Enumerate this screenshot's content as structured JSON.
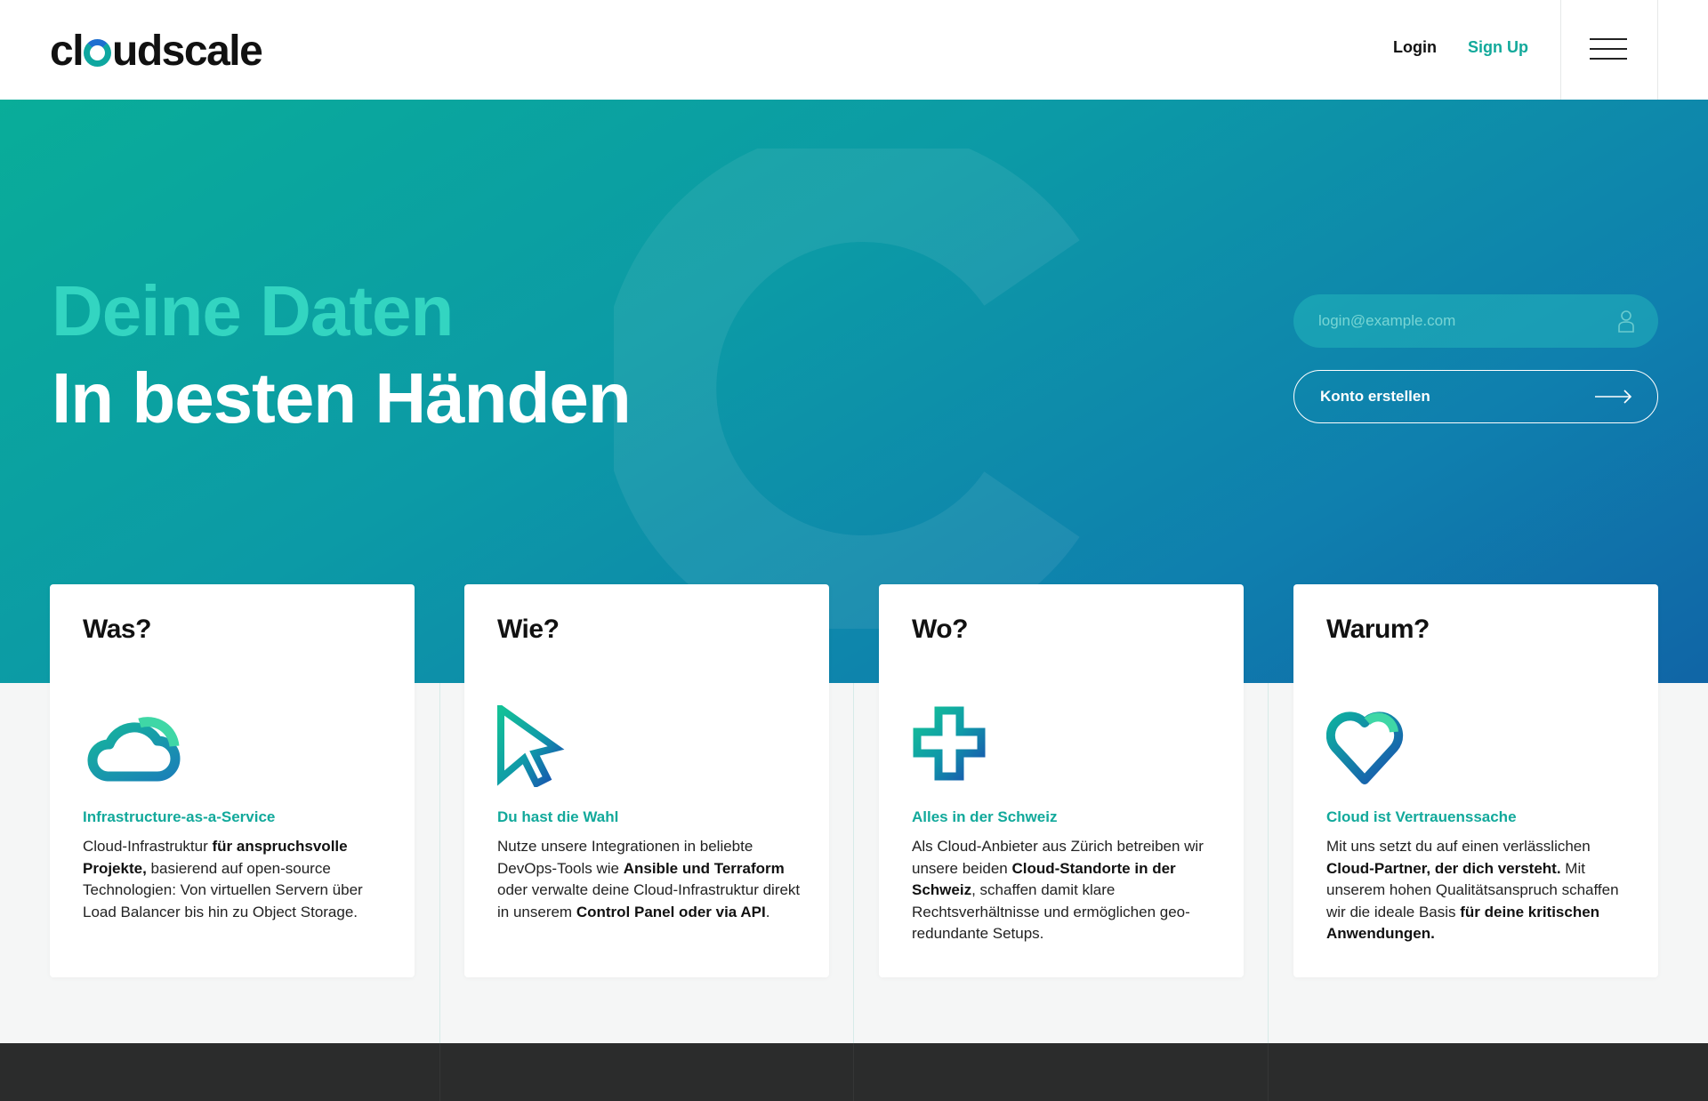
{
  "header": {
    "logo_pre": "cl",
    "logo_post": "udscale",
    "login_label": "Login",
    "signup_label": "Sign Up"
  },
  "hero": {
    "title_line1": "Deine Daten",
    "title_line2": "In besten Händen",
    "email_placeholder": "login@example.com",
    "cta_label": "Konto erstellen"
  },
  "cards": [
    {
      "heading": "Was?",
      "icon": "cloud-icon",
      "subtitle": "Infrastructure-as-a-Service",
      "body": [
        {
          "t": "Cloud-Infrastruktur ",
          "b": false
        },
        {
          "t": "für anspruchsvolle Projekte,",
          "b": true
        },
        {
          "t": " basierend auf open-source Technologien: Von virtuellen Servern über Load Balancer bis hin zu Object Storage.",
          "b": false
        }
      ]
    },
    {
      "heading": "Wie?",
      "icon": "cursor-icon",
      "subtitle": "Du hast die Wahl",
      "body": [
        {
          "t": "Nutze unsere Integrationen in beliebte DevOps-Tools wie ",
          "b": false
        },
        {
          "t": "Ansible und Terraform",
          "b": true
        },
        {
          "t": " oder verwalte deine Cloud-Infrastruktur direkt in unserem ",
          "b": false
        },
        {
          "t": "Control Panel oder via API",
          "b": true
        },
        {
          "t": ".",
          "b": false
        }
      ]
    },
    {
      "heading": "Wo?",
      "icon": "swiss-cross-icon",
      "subtitle": "Alles in der Schweiz",
      "body": [
        {
          "t": "Als Cloud-Anbieter aus Zürich betreiben wir unsere beiden ",
          "b": false
        },
        {
          "t": "Cloud-Standorte in der Schweiz",
          "b": true
        },
        {
          "t": ", schaffen damit klare Rechtsverhältnisse und ermöglichen geo-redundante Setups.",
          "b": false
        }
      ]
    },
    {
      "heading": "Warum?",
      "icon": "heart-icon",
      "subtitle": "Cloud ist Vertrauenssache",
      "body": [
        {
          "t": "Mit uns setzt du auf einen verlässlichen ",
          "b": false
        },
        {
          "t": "Cloud-Partner, der dich versteht.",
          "b": true
        },
        {
          "t": " Mit unserem hohen Qualitätsanspruch schaffen wir die ideale Basis ",
          "b": false
        },
        {
          "t": "für deine kritischen Anwendungen.",
          "b": true
        }
      ]
    }
  ],
  "colors": {
    "accent": "#12a99b",
    "hero_start": "#09ad99",
    "hero_end": "#1065a6",
    "footer": "#2b2c2c"
  }
}
